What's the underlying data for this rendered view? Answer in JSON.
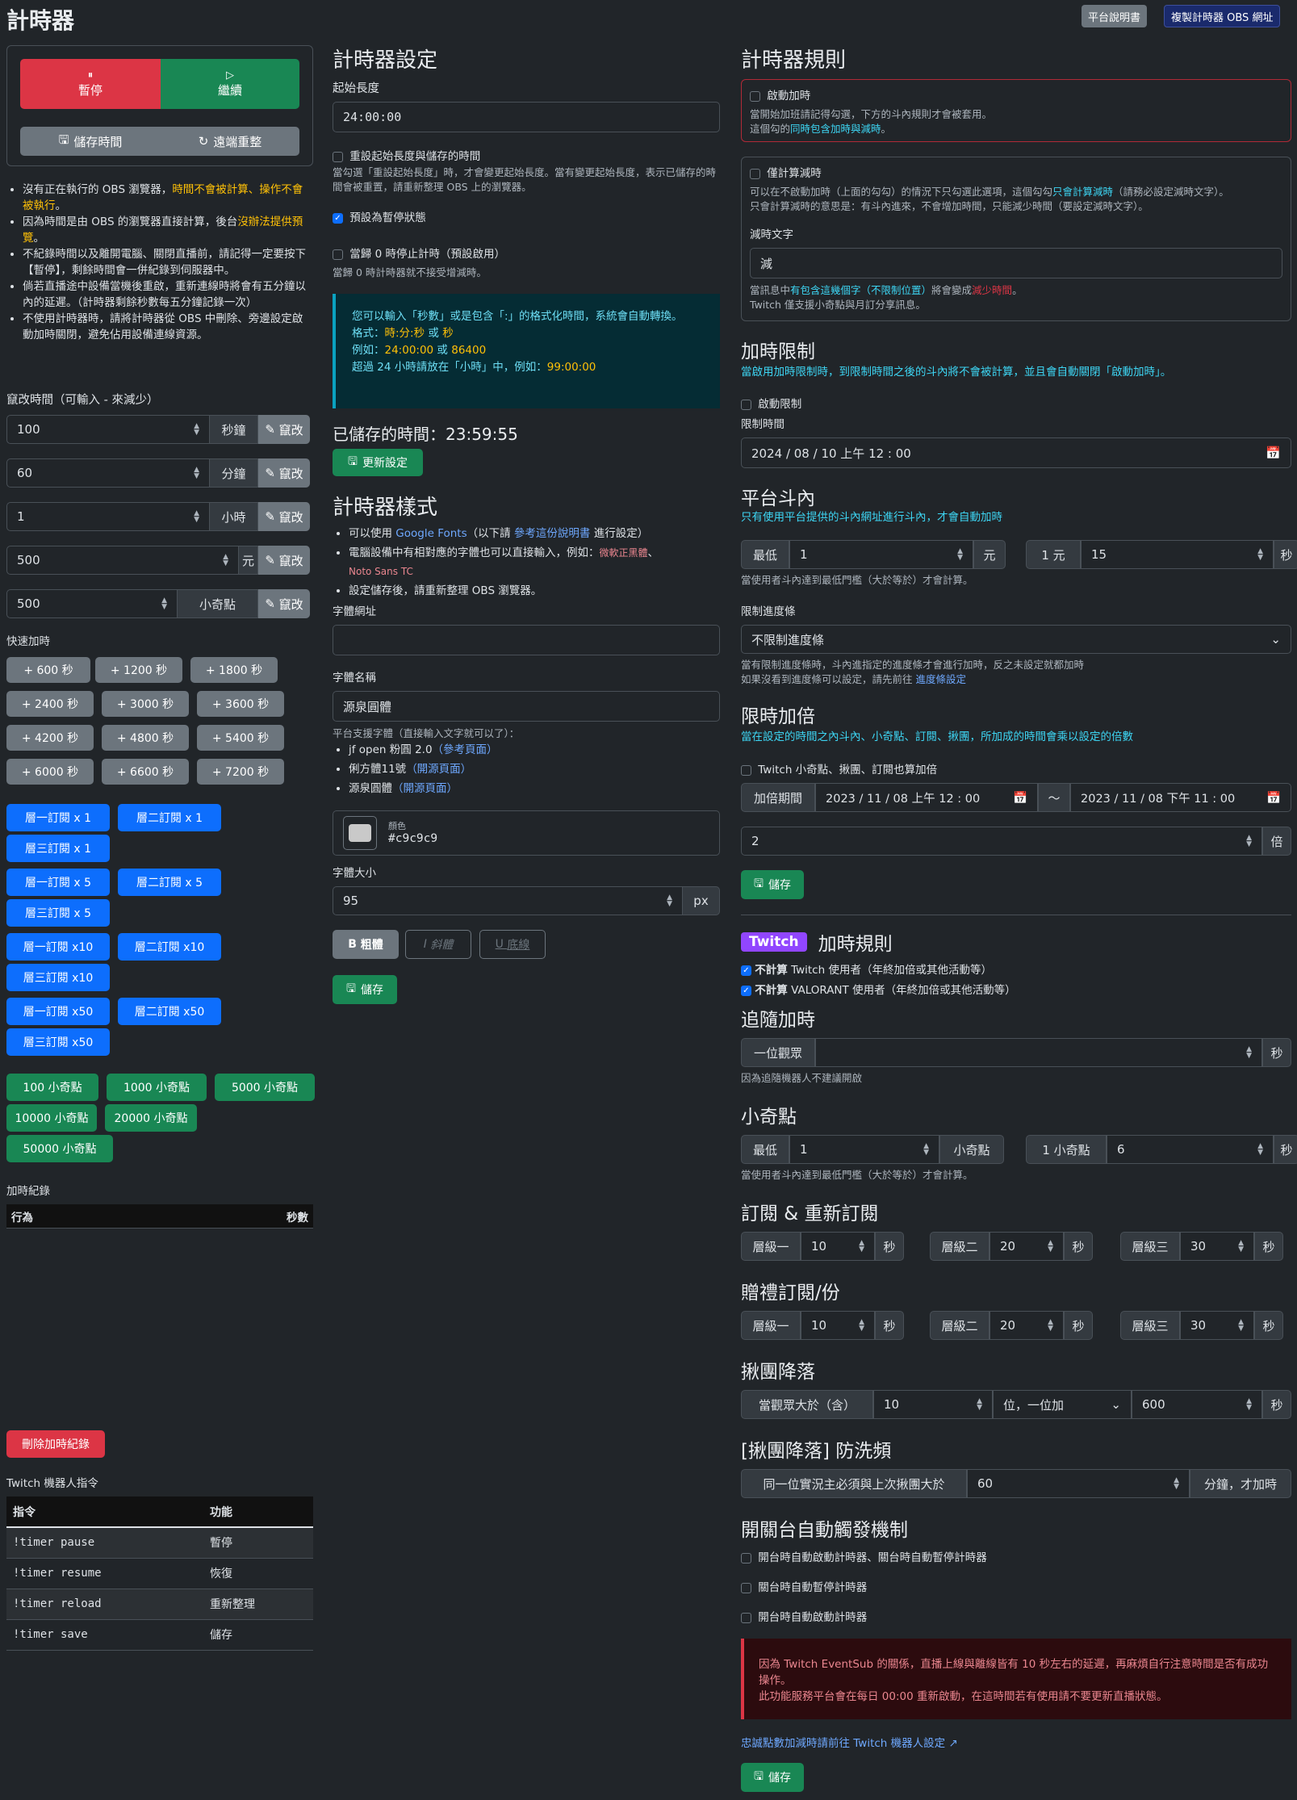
{
  "header": {
    "title": "計時器",
    "manual": "平台說明書",
    "copy_url": "複製計時器 OBS 網址"
  },
  "control": {
    "pause": "暫停",
    "resume": "繼續",
    "save_time": "儲存時間",
    "remote_reset": "遠端重整"
  },
  "notes": [
    [
      "沒有正在執行的 OBS 瀏覽器，",
      "時間不會被計算、操作不會被執行",
      "。"
    ],
    [
      "因為時間是由 OBS 的瀏覽器直接計算，後台",
      "沒辦法提供預覽",
      "。"
    ],
    [
      "不紀錄時間以及離開電腦、關閉直播前，請記得一定要按下【暫停】，剩餘時間會一併紀錄到伺服器中。",
      "",
      ""
    ],
    [
      "倘若直播途中設備當機後重啟，重新連線時將會有五分鐘以內的延遲。（計時器剩餘秒數每五分鐘記錄一次）",
      "",
      ""
    ],
    [
      "不使用計時器時，請將計時器從 OBS 中刪除、旁邊設定啟動加時關閉，避免佔用設備連線資源。",
      "",
      ""
    ]
  ],
  "modify": {
    "label": "竄改時間（可輸入 - 來減少）",
    "btn": "竄改",
    "rows": [
      {
        "value": "100",
        "unit": "秒鐘"
      },
      {
        "value": "60",
        "unit": "分鐘"
      },
      {
        "value": "1",
        "unit": "小時"
      },
      {
        "value": "500",
        "unit": "元"
      },
      {
        "value": "500",
        "unit": "小奇點"
      }
    ]
  },
  "quick": {
    "label": "快速加時",
    "secs": [
      "+ 600 秒",
      "+ 1200 秒",
      "+ 1800 秒",
      "+ 2400 秒",
      "+ 3000 秒",
      "+ 3600 秒",
      "+ 4200 秒",
      "+ 4800 秒",
      "+ 5400 秒",
      "+ 6000 秒",
      "+ 6600 秒",
      "+ 7200 秒"
    ],
    "subs": [
      [
        "層一訂閱 x 1",
        "層二訂閱 x 1"
      ],
      [
        "層三訂閱 x 1"
      ],
      [
        "層一訂閱 x 5",
        "層二訂閱 x 5"
      ],
      [
        "層三訂閱 x 5"
      ],
      [
        "層一訂閱 x10",
        "層二訂閱 x10"
      ],
      [
        "層三訂閱 x10"
      ],
      [
        "層一訂閱 x50",
        "層二訂閱 x50"
      ],
      [
        "層三訂閱 x50"
      ]
    ],
    "bits": [
      [
        "100 小奇點",
        "1000 小奇點",
        "5000 小奇點"
      ],
      [
        "10000 小奇點",
        "20000 小奇點"
      ],
      [
        "50000 小奇點"
      ]
    ]
  },
  "log": {
    "label": "加時紀錄",
    "col_action": "行為",
    "col_secs": "秒數",
    "delete": "刪除加時紀錄"
  },
  "bot": {
    "label": "Twitch 機器人指令",
    "col_cmd": "指令",
    "col_fn": "功能",
    "rows": [
      {
        "cmd": "!timer pause",
        "fn": "暫停"
      },
      {
        "cmd": "!timer resume",
        "fn": "恢復"
      },
      {
        "cmd": "!timer reload",
        "fn": "重新整理"
      },
      {
        "cmd": "!timer save",
        "fn": "儲存"
      }
    ]
  },
  "settings": {
    "title": "計時器設定",
    "start_label": "起始長度",
    "start_value": "24:00:00",
    "reset_label": "重設起始長度與儲存的時間",
    "reset_help": "當勾選「重設起始長度」時，才會變更起始長度。當有變更起始長度，表示已儲存的時間會被重置，請重新整理 OBS 上的瀏覽器。",
    "paused_label": "預設為暫停狀態",
    "stop_label": "當歸 0 時停止計時（預設啟用）",
    "stop_help": "當歸 0 時計時器就不接受增減時。",
    "info": [
      "您可以輸入「秒數」或是包含「:」的格式化時間，系統會自動轉換。",
      "格式：",
      "時:分:秒",
      " 或 ",
      "秒",
      "例如：",
      "24:00:00",
      " 或 ",
      "86400",
      "超過 24 小時請放在「小時」中，例如：",
      "99:00:00"
    ],
    "saved_label": "已儲存的時間：",
    "saved_value": "23:59:55",
    "update": "更新設定"
  },
  "style": {
    "title": "計時器樣式",
    "b1": [
      "可以使用 ",
      "Google Fonts",
      "（以下請 ",
      "參考這份說明書",
      " 進行設定）"
    ],
    "b2": [
      "電腦設備中有相對應的字體也可以直接輸入，例如：",
      "微軟正黑體",
      "、",
      "Noto Sans TC"
    ],
    "b3": "設定儲存後，請重新整理 OBS 瀏覽器。",
    "font_url_label": "字體網址",
    "font_url_value": "",
    "font_name_label": "字體名稱",
    "font_name_value": "源泉圓體",
    "support": "平台支援字體（直接輸入文字就可以了）：",
    "fonts": [
      [
        "jf open 粉圓 2.0",
        "（參考頁面）"
      ],
      [
        "俐方體11號",
        "（開源頁面）"
      ],
      [
        "源泉圓體",
        "（開源頁面）"
      ]
    ],
    "color_label": "顏色",
    "color_value": "#c9c9c9",
    "size_label": "字體大小",
    "size_value": "95",
    "size_unit": "px",
    "bold": "粗體",
    "italic": "斜體",
    "underline": "底線",
    "save": "儲存"
  },
  "rules": {
    "title": "計時器規則",
    "enable": "啟動加時",
    "enable_help1": "當開始加班請記得勾選，下方的斗內規則才會被套用。",
    "enable_help2a": "這個勾的",
    "enable_help2b": "同時包含加時與減時",
    "enable_help2c": "。",
    "subtract_only": "僅計算減時",
    "sub_help1a": "可以在不啟動加時（上面的勾勾）的情況下只勾選此選項，這個勾勾",
    "sub_help1b": "只會計算減時",
    "sub_help1c": "（請務必設定減時文字）。",
    "sub_help2": "只會計算減時的意思是：有斗內進來，不會增加時間，只能減少時間（要設定減時文字）。",
    "sub_text_label": "減時文字",
    "sub_text_value": "減",
    "sub_help3a": "當訊息中",
    "sub_help3b": "有包含這幾個字（不限制位置）",
    "sub_help3c": "將會變成",
    "sub_help3d": "減少時間",
    "sub_help3e": "。",
    "sub_help4": "Twitch 僅支援小奇點與月訂分享訊息。"
  },
  "limit": {
    "title": "加時限制",
    "desc": "當啟用加時限制時，到限制時間之後的斗內將不會被計算，並且會自動關閉「啟動加時」。",
    "enable": "啟動限制",
    "time_label": "限制時間",
    "time_value": "2024 / 08 / 10  上午 12 : 00"
  },
  "donate": {
    "title": "平台斗內",
    "desc": "只有使用平台提供的斗內網址進行斗內，才會自動加時",
    "min": "最低",
    "min_value": "1",
    "yuan": "元",
    "rate_label": "1 元",
    "rate_value": "15",
    "sec": "秒",
    "help": "當使用者斗內達到最低門檻（大於等於）才會計算。",
    "bar_label": "限制進度條",
    "bar_value": "不限制進度條",
    "bar_help1": "當有限制進度條時，斗內進指定的進度條才會進行加時，反之未設定就都加時",
    "bar_help2a": "如果沒看到進度條可以設定，請先前往 ",
    "bar_help2b": "進度條設定"
  },
  "multiplier": {
    "title": "限時加倍",
    "desc": "當在設定的時間之內斗內、小奇點、訂閱、揪團，所加成的時間會乘以設定的倍數",
    "twitch": "Twitch 小奇點、揪團、訂閱也算加倍",
    "period": "加倍期間",
    "from": "2023 / 11 / 08  上午 12 : 00",
    "tilde": "〜",
    "to": "2023 / 11 / 08  下午 11 : 00",
    "value": "2",
    "unit": "倍",
    "save": "儲存"
  },
  "twitch": {
    "badge": "Twitch",
    "title": "加時規則",
    "ex1a": "不計算",
    "ex1b": " Twitch 使用者（年終加倍或其他活動等）",
    "ex2a": "不計算",
    "ex2b": " VALORANT 使用者（年終加倍或其他活動等）",
    "follow_title": "追隨加時",
    "follow_label": "一位觀眾",
    "follow_value": "",
    "sec": "秒",
    "follow_help": "因為追隨機器人不建議開啟",
    "bits_title": "小奇點",
    "bits_min": "最低",
    "bits_min_value": "1",
    "bits_unit": "小奇點",
    "bits_rate": "1 小奇點",
    "bits_rate_value": "6",
    "bits_help": "當使用者斗內達到最低門檻（大於等於）才會計算。",
    "sub_title": "訂閱 & 重新訂閱",
    "gift_title": "贈禮訂閱/份",
    "tiers": [
      "層級一",
      "層級二",
      "層級三"
    ],
    "sub_values": [
      "10",
      "20",
      "30"
    ],
    "gift_values": [
      "10",
      "20",
      "30"
    ],
    "raid_title": "揪團降落",
    "raid_label": "當觀眾大於（含）",
    "raid_value": "10",
    "raid_mode": "位，一位加",
    "raid_secs": "600",
    "anti_title": "[揪團降落] 防洗頻",
    "anti_label": "同一位實況主必須與上次揪團大於",
    "anti_value": "60",
    "anti_unit": "分鐘，才加時",
    "auto_title": "開關台自動觸發機制",
    "auto1": "開台時自動啟動計時器、關台時自動暫停計時器",
    "auto2": "關台時自動暫停計時器",
    "auto3": "開台時自動啟動計時器",
    "warn1": "因為 Twitch EventSub 的關係，直播上線與離線皆有 10 秒左右的延遲，再麻煩自行注意時間是否有成功操作。",
    "warn2": "此功能服務平台會在每日 00:00 重新啟動，在這時間若有使用請不要更新直播狀態。",
    "link": "忠誠點數加減時請前往 Twitch 機器人設定 ↗",
    "save": "儲存"
  }
}
